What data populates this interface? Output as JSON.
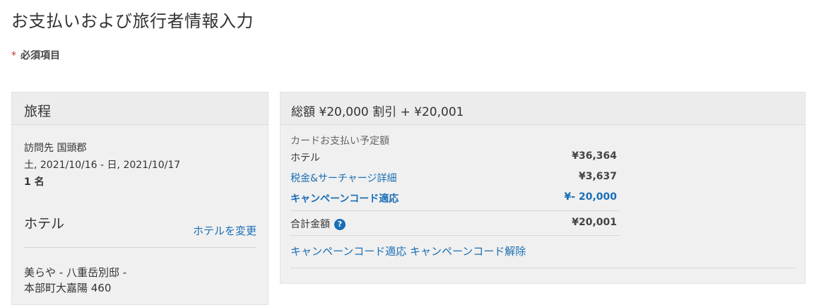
{
  "page": {
    "title": "お支払いおよび旅行者情報入力",
    "required_star": "*",
    "required_label": "必須項目"
  },
  "itinerary": {
    "title": "旅程",
    "destination": "訪問先 国頭郡",
    "dates": "土, 2021/10/16 - 日, 2021/10/17",
    "guests": "1 名",
    "hotel_heading": "ホテル",
    "change_hotel_link": "ホテルを変更",
    "hotel_name_line1": "美らや - 八重岳別邸 -",
    "hotel_name_line2": "本部町大嘉陽 460"
  },
  "summary": {
    "title": "総額 ¥20,000 割引 + ¥20,001",
    "payment_header": "カードお支払い予定額",
    "rows": [
      {
        "label": "ホテル",
        "value": "¥36,364"
      },
      {
        "label": "税金&サーチャージ詳細",
        "value": "¥3,637"
      },
      {
        "label": "キャンペーンコード適応",
        "value": "¥- 20,000"
      }
    ],
    "total_label": "合計金額",
    "help_icon_glyph": "?",
    "total_value": "¥20,001",
    "campaign_apply_link": "キャンペーンコード適応",
    "campaign_remove_link": "キャンペーンコード解除"
  },
  "colors": {
    "link": "#1a6fb5",
    "panel_bg": "#f0f0f0",
    "required_star": "#c0392b"
  }
}
